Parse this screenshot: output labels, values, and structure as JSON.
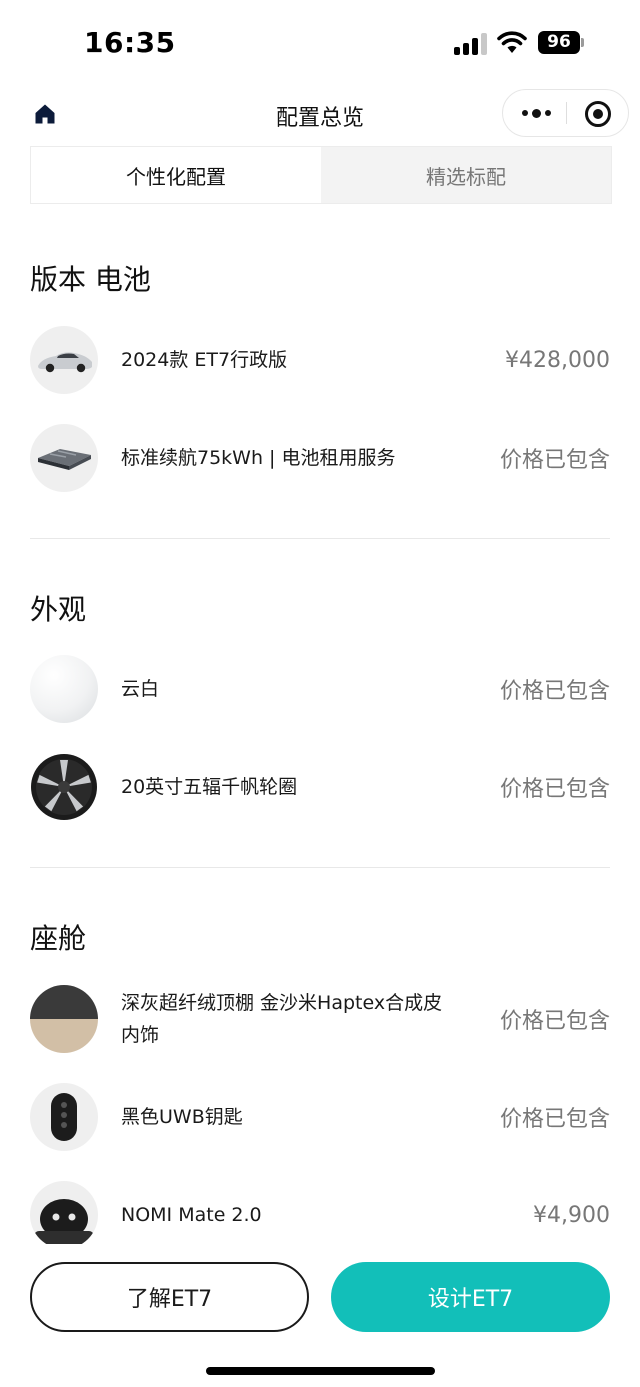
{
  "status_bar": {
    "time": "16:35",
    "battery": "96"
  },
  "nav": {
    "title": "配置总览"
  },
  "tabs": [
    {
      "label": "个性化配置",
      "active": true
    },
    {
      "label": "精选标配",
      "active": false
    }
  ],
  "sections": [
    {
      "title": "版本 电池",
      "items": [
        {
          "name": "2024款 ET7行政版",
          "price": "¥428,000",
          "icon": "car-thumbnail"
        },
        {
          "name": "标准续航75kWh | 电池租用服务",
          "price": "价格已包含",
          "icon": "battery-pack-thumbnail"
        }
      ]
    },
    {
      "title": "外观",
      "items": [
        {
          "name": "云白",
          "price": "价格已包含",
          "icon": "white-color-swatch"
        },
        {
          "name": "20英寸五辐千帆轮圈",
          "price": "价格已包含",
          "icon": "wheel-thumbnail"
        }
      ]
    },
    {
      "title": "座舱",
      "items": [
        {
          "name": "深灰超纤绒顶棚 金沙米Haptex合成皮内饰",
          "price": "价格已包含",
          "icon": "interior-swatch"
        },
        {
          "name": "黑色UWB钥匙",
          "price": "价格已包含",
          "icon": "key-fob-thumbnail"
        },
        {
          "name": "NOMI Mate 2.0",
          "price": "¥4,900",
          "icon": "nomi-thumbnail"
        }
      ]
    }
  ],
  "buttons": {
    "learn": "了解ET7",
    "design": "设计ET7"
  },
  "colors": {
    "accent": "#12bfb9",
    "text_primary": "#1a1a1a",
    "text_secondary": "#777777"
  }
}
